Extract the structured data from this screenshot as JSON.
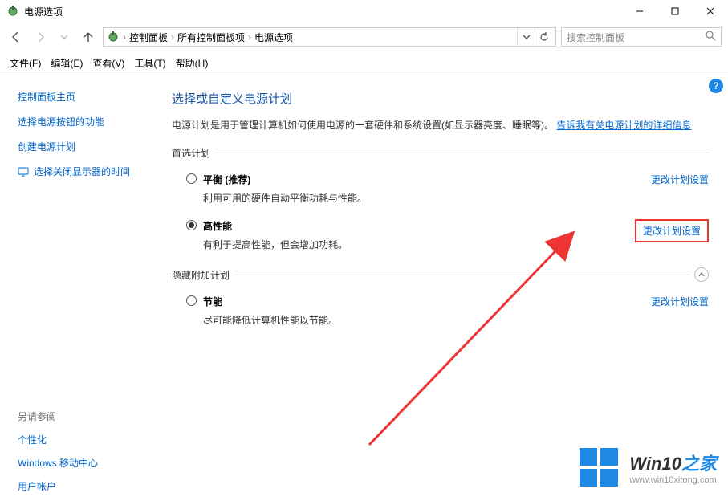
{
  "window": {
    "title": "电源选项"
  },
  "breadcrumb": {
    "items": [
      "控制面板",
      "所有控制面板项",
      "电源选项"
    ]
  },
  "search": {
    "placeholder": "搜索控制面板"
  },
  "menubar": {
    "file": "文件(F)",
    "edit": "编辑(E)",
    "view": "查看(V)",
    "tools": "工具(T)",
    "help": "帮助(H)"
  },
  "sidebar": {
    "home": "控制面板主页",
    "items": [
      "选择电源按钮的功能",
      "创建电源计划",
      "选择关闭显示器的时间"
    ],
    "footer_title": "另请参阅",
    "footer_items": [
      "个性化",
      "Windows 移动中心",
      "用户帐户"
    ]
  },
  "main": {
    "heading": "选择或自定义电源计划",
    "description": "电源计划是用于管理计算机如何使用电源的一套硬件和系统设置(如显示器亮度、睡眠等)。",
    "more_info": "告诉我有关电源计划的详细信息",
    "preferred_label": "首选计划",
    "hidden_label": "隐藏附加计划",
    "change_plan": "更改计划设置",
    "plans": [
      {
        "name": "平衡 (推荐)",
        "hint": "利用可用的硬件自动平衡功耗与性能。",
        "selected": false
      },
      {
        "name": "高性能",
        "hint": "有利于提高性能，但会增加功耗。",
        "selected": true
      },
      {
        "name": "节能",
        "hint": "尽可能降低计算机性能以节能。",
        "selected": false
      }
    ]
  },
  "watermark": {
    "brand_main": "Win10",
    "brand_suffix": "之家",
    "url": "www.win10xitong.com"
  }
}
